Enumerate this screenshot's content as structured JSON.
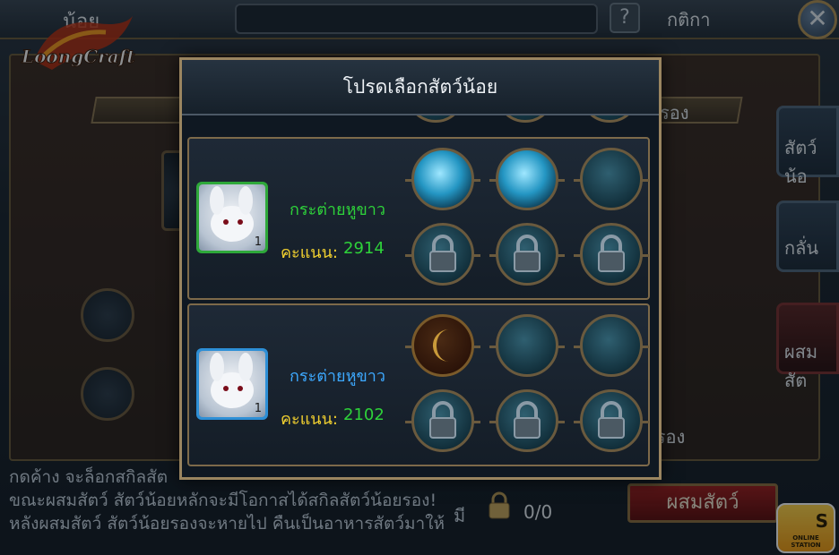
{
  "background": {
    "title_left": "น้อย",
    "help": "?",
    "rules": "กติกา",
    "close": "✕",
    "ribbon_text": "รอง",
    "side_tabs": [
      "สัตว์น้อ",
      "กลั่น",
      "ผสมสัต"
    ],
    "lock_hint": "ยรอง",
    "info_lines": [
      "กดค้าง จะล็อกสกิลสัต",
      "ขณะผสมสัตว์ สัตว์น้อยหลักจะมีโอกาสได้สกิลสัตว์น้อยรอง!",
      "หลังผสมสัตว์ สัตว์น้อยรองจะหายไป คืนเป็นอาหารสัตว์มาให้"
    ],
    "count_label": "มี",
    "count_value": "0/0",
    "merge_button": "ผสมสัตว์",
    "badge_text": "ONLINE STATION",
    "badge_letter": "S"
  },
  "dialog": {
    "title": "โปรดเลือกสัตว์น้อย",
    "pets": [
      {
        "name": "กระต่ายหูขาว",
        "score_label": "คะแนน:",
        "score": "2914",
        "level": "1",
        "frame_color": "#2ea83a",
        "name_color": "#2ed23a",
        "skills": [
          "skill-icon",
          "skill-icon",
          "empty-slot",
          "lock-icon",
          "lock-icon",
          "lock-icon"
        ]
      },
      {
        "name": "กระต่ายหูขาว",
        "score_label": "คะแนน:",
        "score": "2102",
        "level": "1",
        "frame_color": "#2d8fd6",
        "name_color": "#3da9ff",
        "skills": [
          "gold-skill-icon",
          "empty-slot",
          "empty-slot",
          "lock-icon",
          "lock-icon",
          "lock-icon"
        ]
      }
    ]
  },
  "logo_text": "LoongCraft"
}
